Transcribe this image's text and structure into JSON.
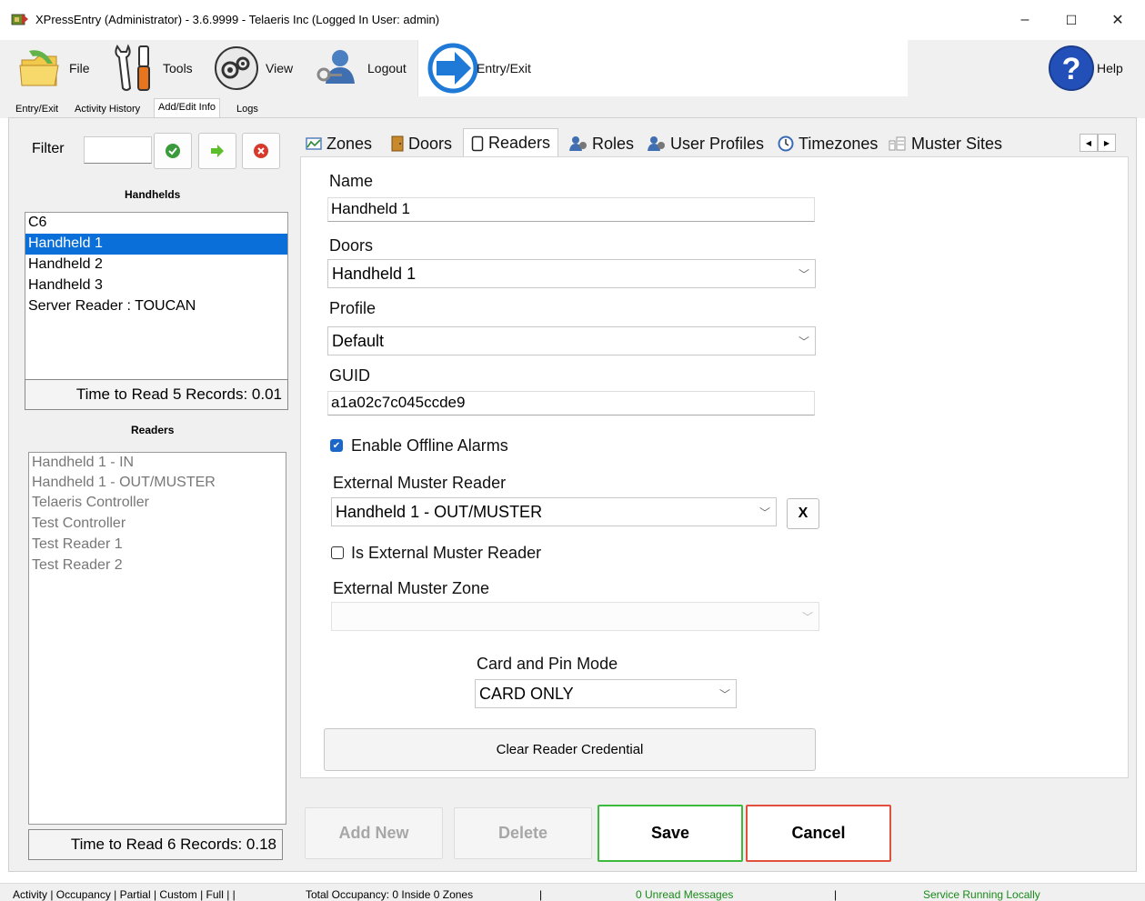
{
  "window": {
    "title": "XPressEntry (Administrator)  - 3.6.9999 - Telaeris Inc (Logged In User: admin)",
    "minimize": "–",
    "maximize": "☐",
    "close": "✕"
  },
  "toolbar": {
    "file": "File",
    "tools": "Tools",
    "view": "View",
    "logout": "Logout",
    "entry_exit": "Entry/Exit",
    "help": "Help"
  },
  "top_tabs": [
    {
      "label": "Entry/Exit"
    },
    {
      "label": "Activity History"
    },
    {
      "label": "Add/Edit Info",
      "active": true
    },
    {
      "label": "Logs"
    }
  ],
  "left": {
    "filter_label": "Filter",
    "filter_value": "",
    "handhelds_header": "Handhelds",
    "handhelds": [
      {
        "label": "C6"
      },
      {
        "label": "Handheld 1",
        "selected": true
      },
      {
        "label": "Handheld 2"
      },
      {
        "label": "Handheld 3"
      },
      {
        "label": "Server Reader : TOUCAN"
      }
    ],
    "handhelds_time": "Time to Read 5 Records: 0.01",
    "readers_header": "Readers",
    "readers": [
      {
        "label": "Handheld 1 - IN"
      },
      {
        "label": "Handheld 1 - OUT/MUSTER"
      },
      {
        "label": "Telaeris Controller"
      },
      {
        "label": "Test Controller"
      },
      {
        "label": "Test Reader 1"
      },
      {
        "label": "Test Reader 2"
      }
    ],
    "readers_time": "Time to Read 6 Records: 0.18"
  },
  "tabs": [
    {
      "label": "Zones",
      "icon": "zones-icon"
    },
    {
      "label": "Doors",
      "icon": "door-icon"
    },
    {
      "label": "Readers",
      "icon": "reader-icon",
      "active": true
    },
    {
      "label": "Roles",
      "icon": "roles-icon"
    },
    {
      "label": "User Profiles",
      "icon": "user-profiles-icon"
    },
    {
      "label": "Timezones",
      "icon": "clock-icon"
    },
    {
      "label": "Muster Sites",
      "icon": "muster-sites-icon"
    }
  ],
  "form": {
    "name_label": "Name",
    "name_value": "Handheld 1",
    "doors_label": "Doors",
    "doors_value": "Handheld 1",
    "profile_label": "Profile",
    "profile_value": "Default",
    "guid_label": "GUID",
    "guid_value": "a1a02c7c045ccde9",
    "enable_offline_alarms": "Enable Offline Alarms",
    "enable_offline_alarms_checked": true,
    "external_muster_reader_label": "External Muster Reader",
    "external_muster_reader_value": "Handheld 1 - OUT/MUSTER",
    "clear_x": "X",
    "is_external_muster_reader": "Is External Muster Reader",
    "is_external_muster_reader_checked": false,
    "external_muster_zone_label": "External Muster Zone",
    "external_muster_zone_value": "",
    "card_pin_label": "Card and Pin Mode",
    "card_pin_value": "CARD ONLY",
    "clear_credential": "Clear Reader Credential"
  },
  "actions": {
    "add_new": "Add New",
    "delete": "Delete",
    "save": "Save",
    "cancel": "Cancel"
  },
  "status": {
    "modes": "Activity | Occupancy | Partial | Custom | Full | |",
    "occupancy": "Total Occupancy: 0 Inside 0 Zones",
    "sep1": "|",
    "messages": "0 Unread Messages",
    "sep2": "|",
    "service": "Service Running Locally"
  },
  "colors": {
    "selection": "#0a6fd9",
    "save_border": "#3cba3c",
    "cancel_border": "#e0503c",
    "status_green": "#1a8a1a",
    "checkbox": "#1a66c9"
  }
}
